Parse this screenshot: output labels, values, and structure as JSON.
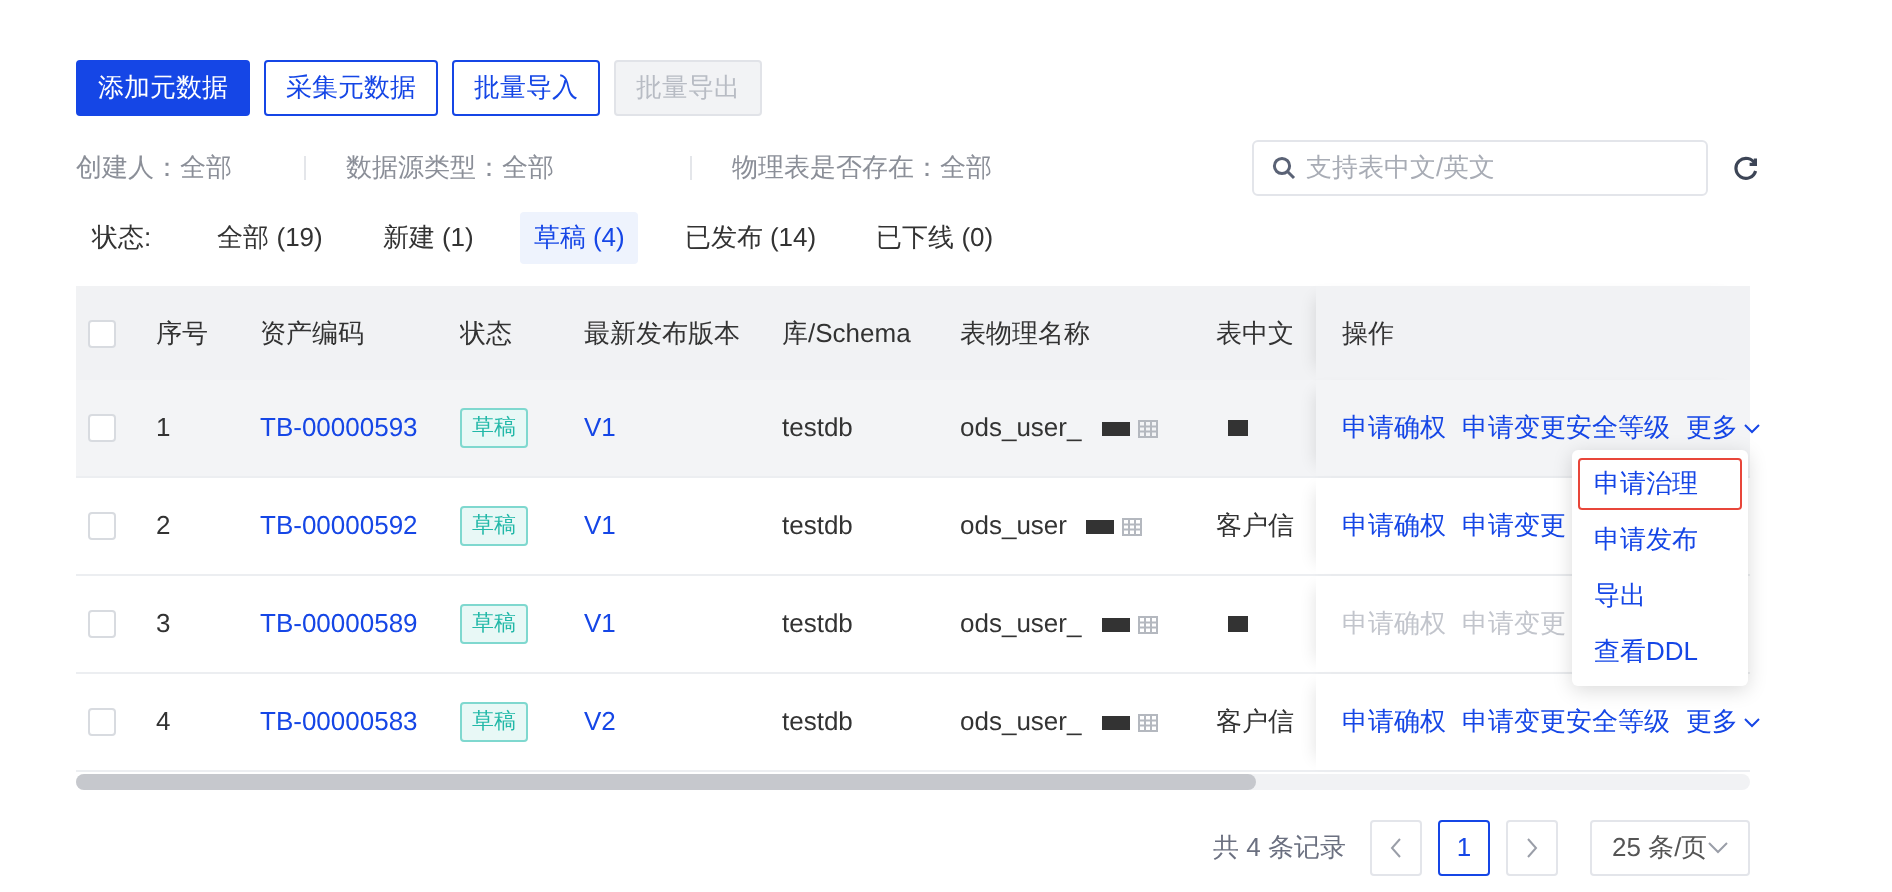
{
  "toolbar": {
    "buttons": [
      {
        "label": "添加元数据",
        "kind": "primary"
      },
      {
        "label": "采集元数据",
        "kind": "outline"
      },
      {
        "label": "批量导入",
        "kind": "outline"
      },
      {
        "label": "批量导出",
        "kind": "disabled"
      }
    ]
  },
  "filters": [
    {
      "text": "创建人：全部"
    },
    {
      "text": "数据源类型：全部"
    },
    {
      "text": "物理表是否存在：全部"
    }
  ],
  "search": {
    "placeholder": "支持表中文/英文"
  },
  "status_tabs": {
    "label": "状态:",
    "tabs": [
      {
        "label": "全部 (19)",
        "selected": false
      },
      {
        "label": "新建 (1)",
        "selected": false
      },
      {
        "label": "草稿 (4)",
        "selected": true
      },
      {
        "label": "已发布 (14)",
        "selected": false
      },
      {
        "label": "已下线 (0)",
        "selected": false
      }
    ]
  },
  "table": {
    "header_checked": false,
    "columns": [
      "序号",
      "资产编码",
      "状态",
      "最新发布版本",
      "库/Schema",
      "表物理名称",
      "表中文",
      "操作"
    ],
    "rows": [
      {
        "checked": false,
        "highlighted": true,
        "disabled": false,
        "index": "1",
        "code": "TB-00000593",
        "status": "草稿",
        "version": "V1",
        "schema": "testdb",
        "physical_name": "ods_user_",
        "name_redacted": true,
        "chinese_redacted": true,
        "actions": [
          "申请确权",
          "申请变更安全等级"
        ],
        "more": "更多"
      },
      {
        "checked": false,
        "highlighted": false,
        "disabled": false,
        "index": "2",
        "code": "TB-00000592",
        "status": "草稿",
        "version": "V1",
        "schema": "testdb",
        "physical_name": "ods_user",
        "name_redacted": true,
        "chinese_name": "客户信",
        "actions": [
          "申请确权",
          "申请变更"
        ]
      },
      {
        "checked": false,
        "highlighted": false,
        "disabled": true,
        "index": "3",
        "code": "TB-00000589",
        "status": "草稿",
        "version": "V1",
        "schema": "testdb",
        "physical_name": "ods_user_",
        "name_redacted": true,
        "chinese_redacted": true,
        "actions": [
          "申请确权",
          "申请变更"
        ]
      },
      {
        "checked": false,
        "highlighted": false,
        "disabled": false,
        "index": "4",
        "code": "TB-00000583",
        "status": "草稿",
        "version": "V2",
        "schema": "testdb",
        "physical_name": "ods_user_",
        "name_redacted": true,
        "chinese_name": "客户信",
        "actions": [
          "申请确权",
          "申请变更安全等级"
        ],
        "more": "更多"
      }
    ]
  },
  "dropdown": {
    "items": [
      {
        "label": "申请治理",
        "selected": true
      },
      {
        "label": "申请发布",
        "selected": false
      },
      {
        "label": "导出",
        "selected": false
      },
      {
        "label": "查看DDL",
        "selected": false
      }
    ]
  },
  "pagination": {
    "total": "共 4 条记录",
    "pages": [
      {
        "label": "1",
        "selected": true
      }
    ],
    "page_size": "25 条/页"
  }
}
